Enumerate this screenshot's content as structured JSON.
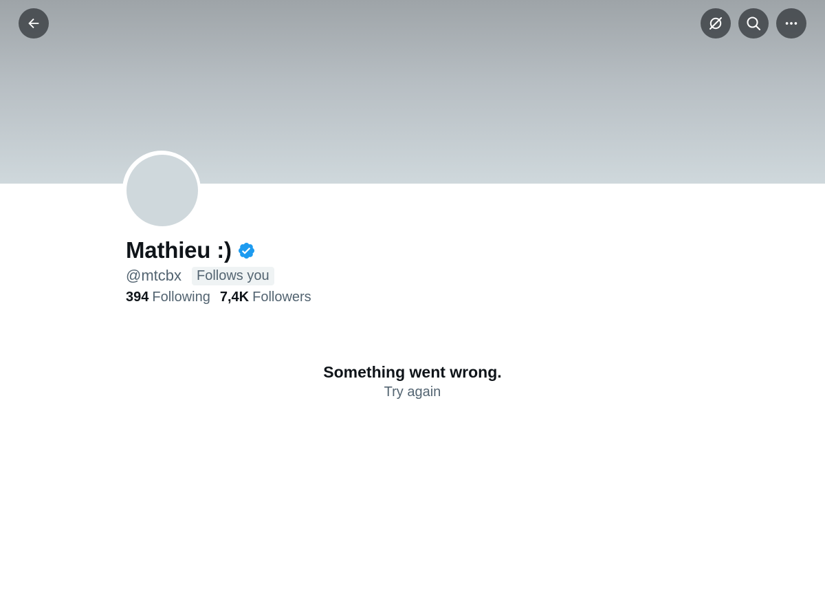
{
  "header": {
    "back_icon": "arrow-left-icon",
    "grok_icon": "grok-icon",
    "search_icon": "search-icon",
    "more_icon": "more-horizontal-icon"
  },
  "profile": {
    "display_name": "Mathieu :)",
    "verified_icon": "verified-badge-icon",
    "verified_color": "#1d9bf0",
    "handle": "@mtcbx",
    "follows_you_label": "Follows you",
    "following_count": "394",
    "following_label": "Following",
    "followers_count": "7,4K",
    "followers_label": "Followers"
  },
  "error": {
    "title": "Something went wrong.",
    "retry_label": "Try again"
  },
  "colors": {
    "text_primary": "#0f1419",
    "text_secondary": "#536471",
    "banner_top": "#9ea4a8",
    "banner_bottom": "#cfd8dc",
    "avatar_placeholder": "#cfd8dc",
    "badge_background": "#eff3f4"
  }
}
